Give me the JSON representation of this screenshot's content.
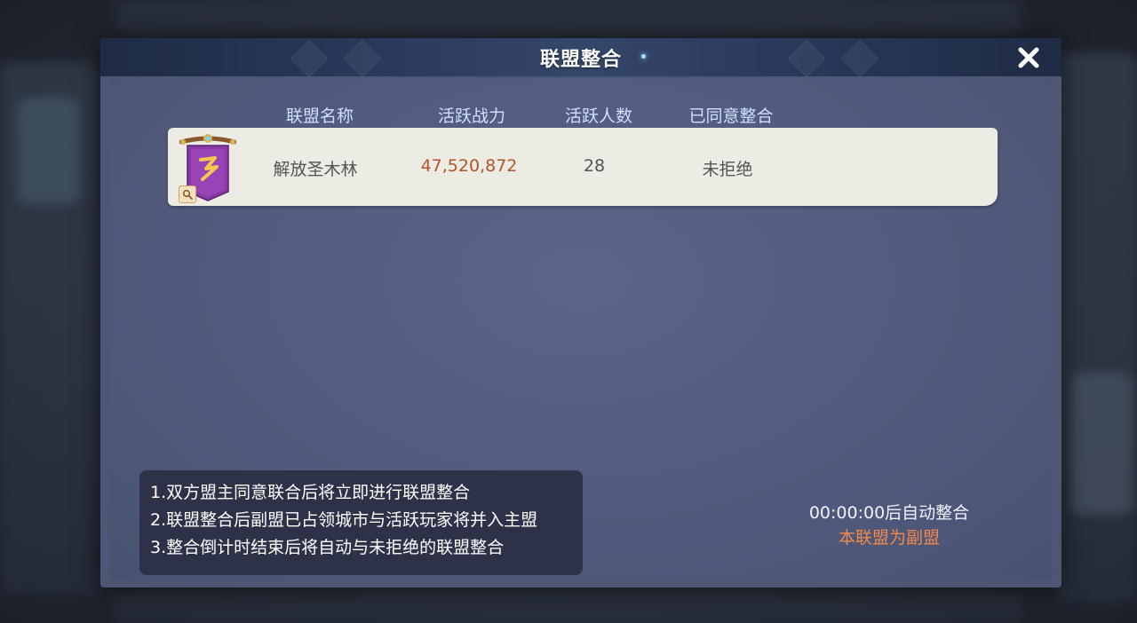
{
  "dialog": {
    "title": "联盟整合",
    "close_icon": "close-icon"
  },
  "table": {
    "headers": [
      "联盟名称",
      "活跃战力",
      "活跃人数",
      "已同意整合"
    ],
    "rows": [
      {
        "emblem_icon": "alliance-banner-emblem",
        "name": "解放圣木林",
        "active_power": "47,520,872",
        "active_members": "28",
        "agreed": "未拒绝"
      }
    ]
  },
  "rules": [
    "1.双方盟主同意联合后将立即进行联盟整合",
    "2.联盟整合后副盟已占领城市与活跃玩家将并入主盟",
    "3.整合倒计时结束后将自动与未拒绝的联盟整合"
  ],
  "status": {
    "countdown": "00:00:00后自动整合",
    "role": "本联盟为副盟"
  },
  "colors": {
    "panel": "#4e5676",
    "header": "#2b3a5c",
    "row_bg": "#ecebe4",
    "power_text": "#b5532b",
    "role_text": "#f08a4b",
    "info_bg": "#2d3248"
  }
}
